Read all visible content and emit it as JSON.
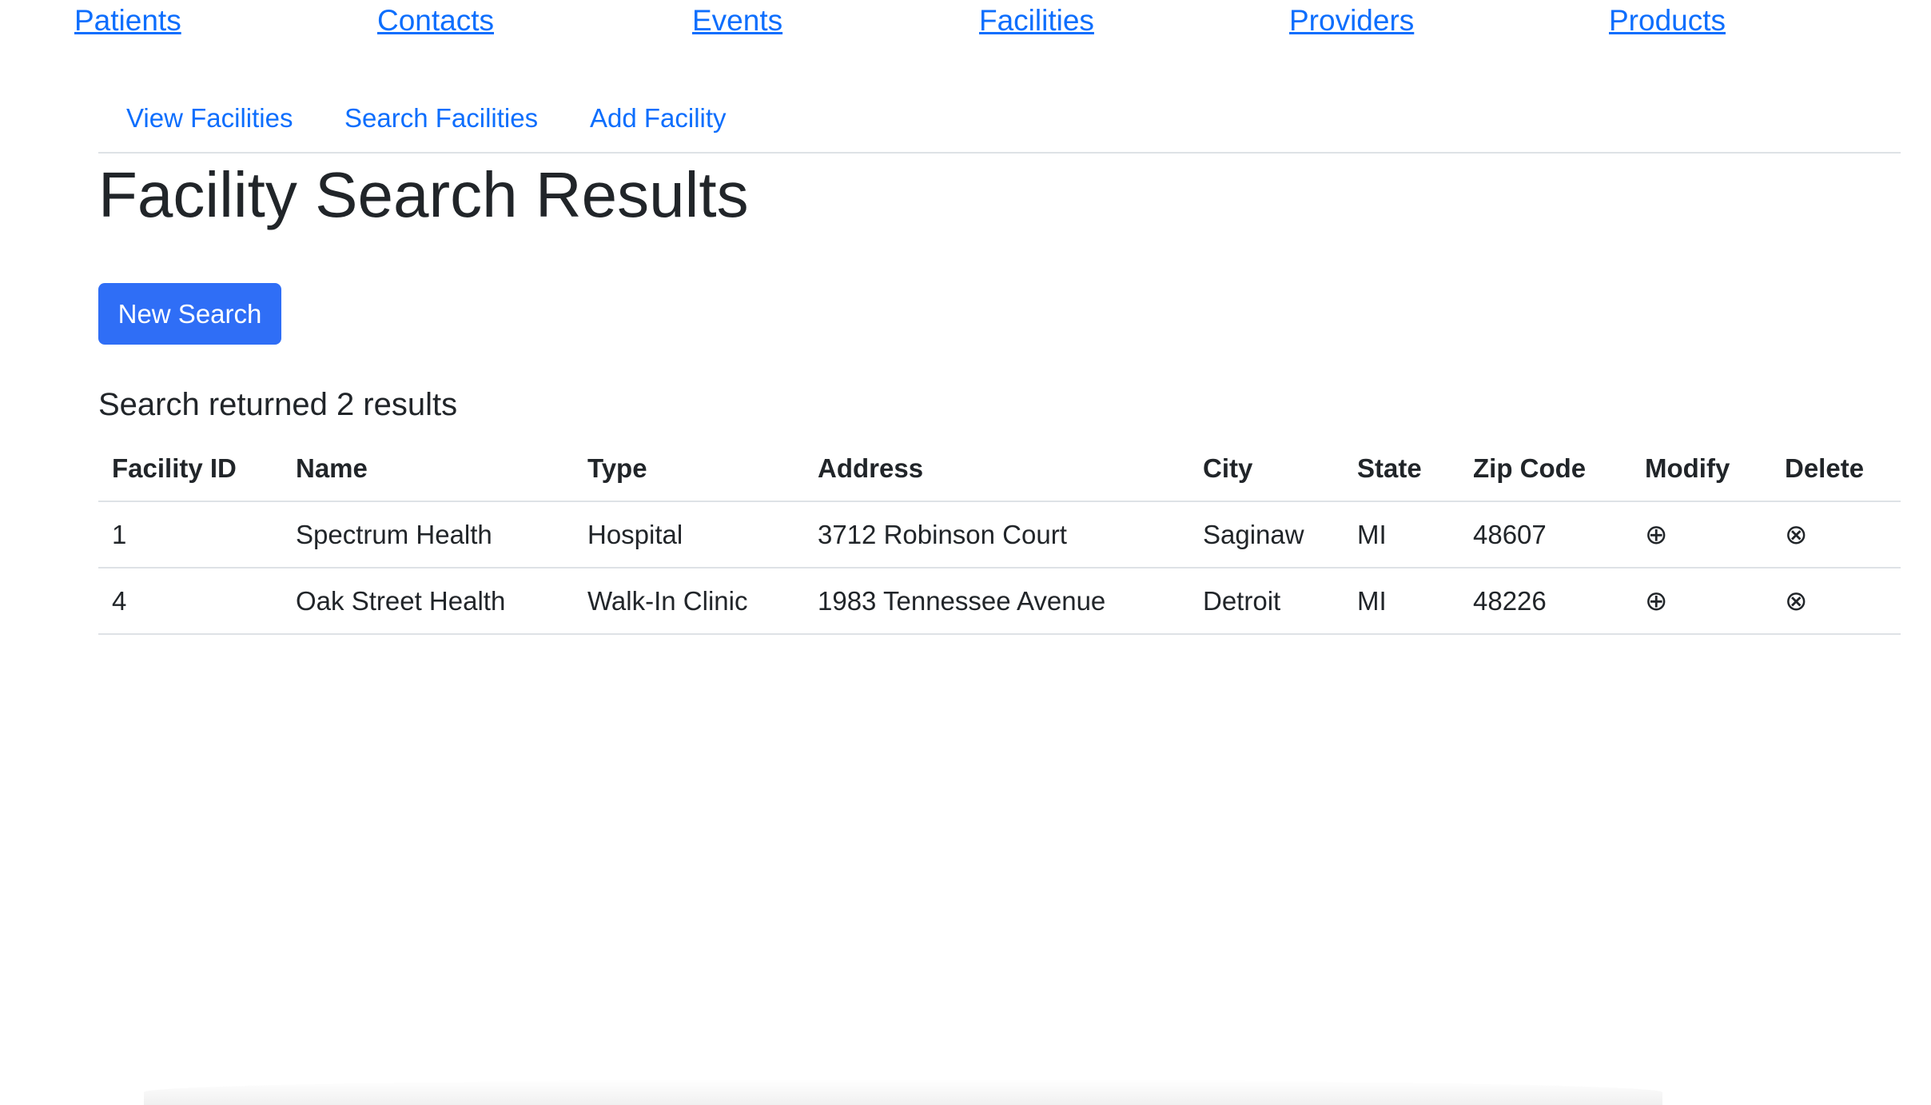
{
  "top_nav": [
    {
      "label": "Patients"
    },
    {
      "label": "Contacts"
    },
    {
      "label": "Events"
    },
    {
      "label": "Facilities"
    },
    {
      "label": "Providers"
    },
    {
      "label": "Products"
    }
  ],
  "sub_tabs": [
    {
      "label": "View Facilities"
    },
    {
      "label": "Search Facilities"
    },
    {
      "label": "Add Facility"
    }
  ],
  "page_title": "Facility Search Results",
  "new_search_label": "New Search",
  "result_summary": "Search returned 2 results",
  "table": {
    "headers": [
      "Facility ID",
      "Name",
      "Type",
      "Address",
      "City",
      "State",
      "Zip Code",
      "Modify",
      "Delete"
    ],
    "rows": [
      {
        "id": "1",
        "name": "Spectrum Health",
        "type": "Hospital",
        "address": "3712 Robinson Court",
        "city": "Saginaw",
        "state": "MI",
        "zip": "48607",
        "modify_icon": "⊕",
        "delete_icon": "⊗"
      },
      {
        "id": "4",
        "name": "Oak Street Health",
        "type": "Walk-In Clinic",
        "address": "1983 Tennessee Avenue",
        "city": "Detroit",
        "state": "MI",
        "zip": "48226",
        "modify_icon": "⊕",
        "delete_icon": "⊗"
      }
    ]
  },
  "colors": {
    "link": "#0d6efd",
    "primary_button": "#2f6ef6",
    "text": "#212529",
    "border": "#dee2e6"
  },
  "icons": {
    "modify": "circled-plus-icon",
    "delete": "circled-x-icon"
  }
}
